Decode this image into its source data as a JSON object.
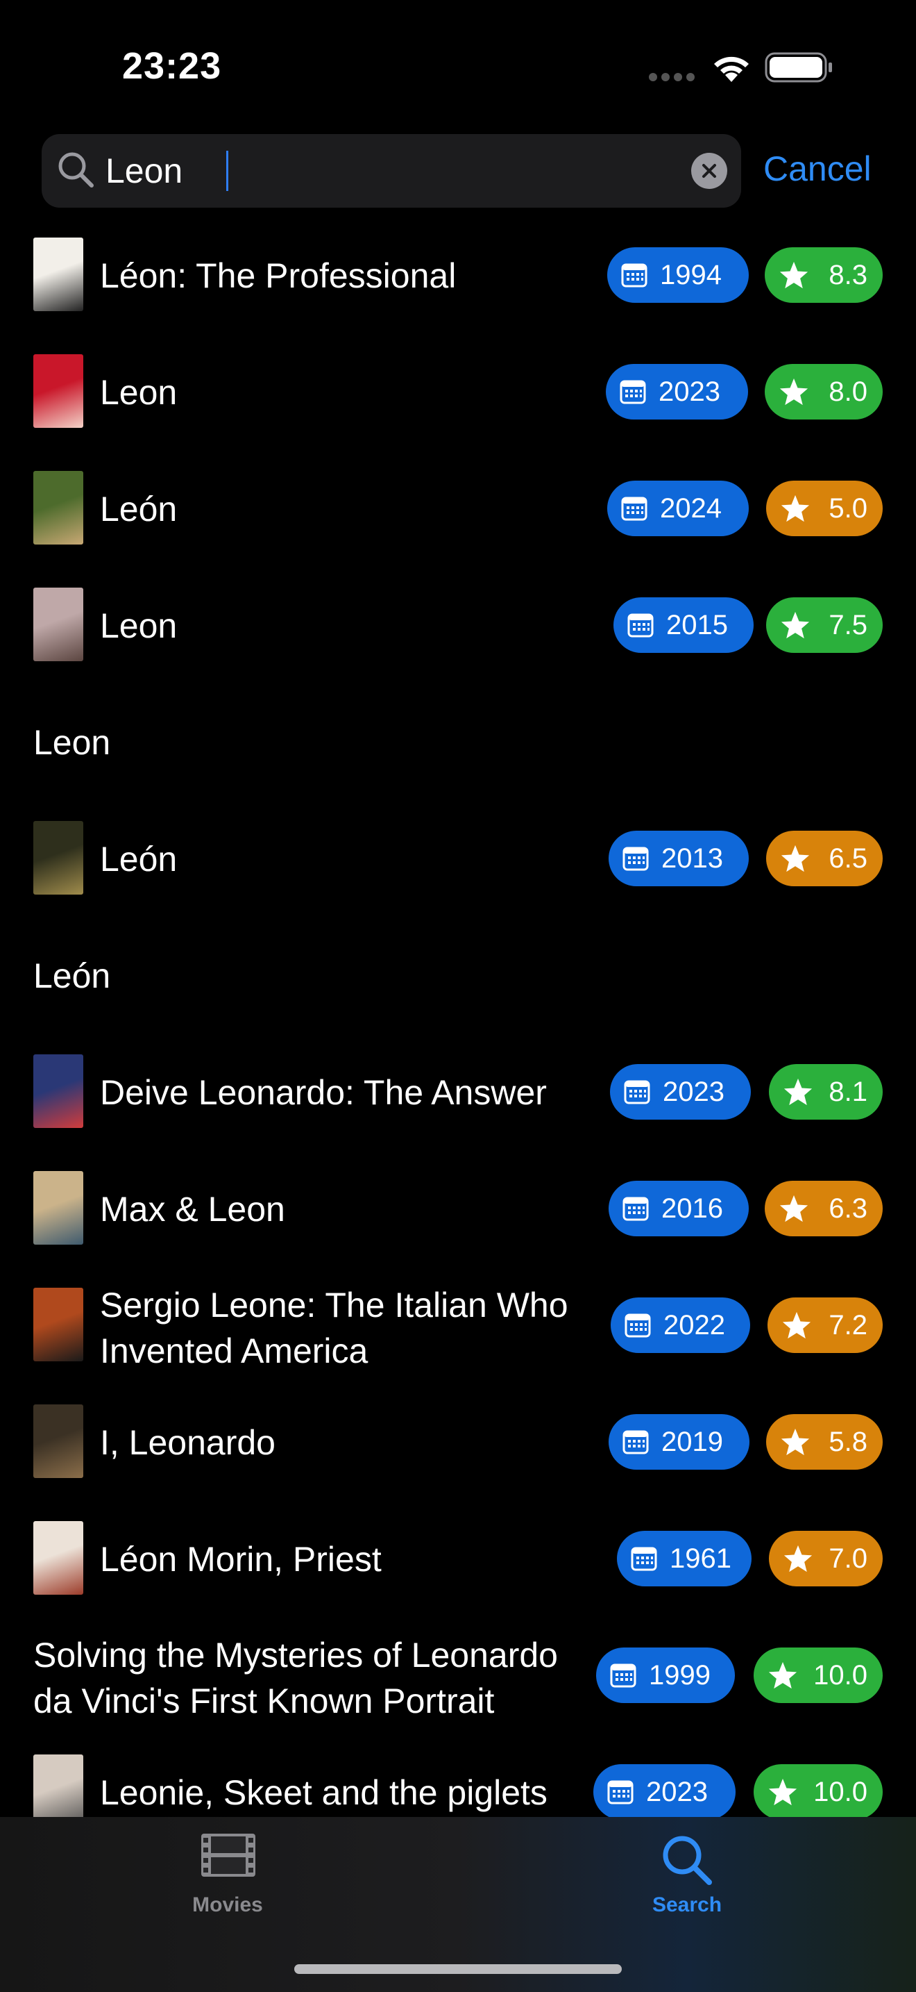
{
  "status_bar": {
    "time": "23:23"
  },
  "search": {
    "value": "Leon",
    "cancel_label": "Cancel"
  },
  "colors": {
    "year_badge": "#0f68d9",
    "rating_green": "#2bb03c",
    "rating_orange": "#d8830b",
    "accent": "#2f8cf5"
  },
  "results": [
    {
      "title": "Léon: The Professional",
      "year": "1994",
      "rating": "8.3",
      "rating_color": "green",
      "poster": "poster-leon-professional"
    },
    {
      "title": "Leon",
      "year": "2023",
      "rating": "8.0",
      "rating_color": "green",
      "poster": "poster-leon-2023"
    },
    {
      "title": "León",
      "year": "2024",
      "rating": "5.0",
      "rating_color": "orange",
      "poster": "poster-leon-2024"
    },
    {
      "title": "Leon",
      "year": "2015",
      "rating": "7.5",
      "rating_color": "green",
      "poster": "poster-leon-2015"
    },
    {
      "title": "Leon"
    },
    {
      "title": "León",
      "year": "2013",
      "rating": "6.5",
      "rating_color": "orange",
      "poster": "poster-leon-2013"
    },
    {
      "title": "León"
    },
    {
      "title": "Deive Leonardo: The Answer",
      "year": "2023",
      "rating": "8.1",
      "rating_color": "green",
      "poster": "poster-deive-leonardo"
    },
    {
      "title": "Max & Leon",
      "year": "2016",
      "rating": "6.3",
      "rating_color": "orange",
      "poster": "poster-max-leon"
    },
    {
      "title": "Sergio Leone: The Italian Who Invented America",
      "year": "2022",
      "rating": "7.2",
      "rating_color": "orange",
      "poster": "poster-sergio-leone"
    },
    {
      "title": "I, Leonardo",
      "year": "2019",
      "rating": "5.8",
      "rating_color": "orange",
      "poster": "poster-i-leonardo"
    },
    {
      "title": "Léon Morin, Priest",
      "year": "1961",
      "rating": "7.0",
      "rating_color": "orange",
      "poster": "poster-leon-morin"
    },
    {
      "title": "Solving the Mysteries of Leonardo da Vinci's First Known Portrait",
      "year": "1999",
      "rating": "10.0",
      "rating_color": "green"
    },
    {
      "title": "Leonie, Skeet and the piglets",
      "year": "2023",
      "rating": "10.0",
      "rating_color": "green",
      "poster": "poster-leonie-skeet"
    }
  ],
  "tabs": [
    {
      "label": "Movies",
      "icon": "film-icon",
      "selected": false
    },
    {
      "label": "Search",
      "icon": "search-icon",
      "selected": true
    }
  ]
}
